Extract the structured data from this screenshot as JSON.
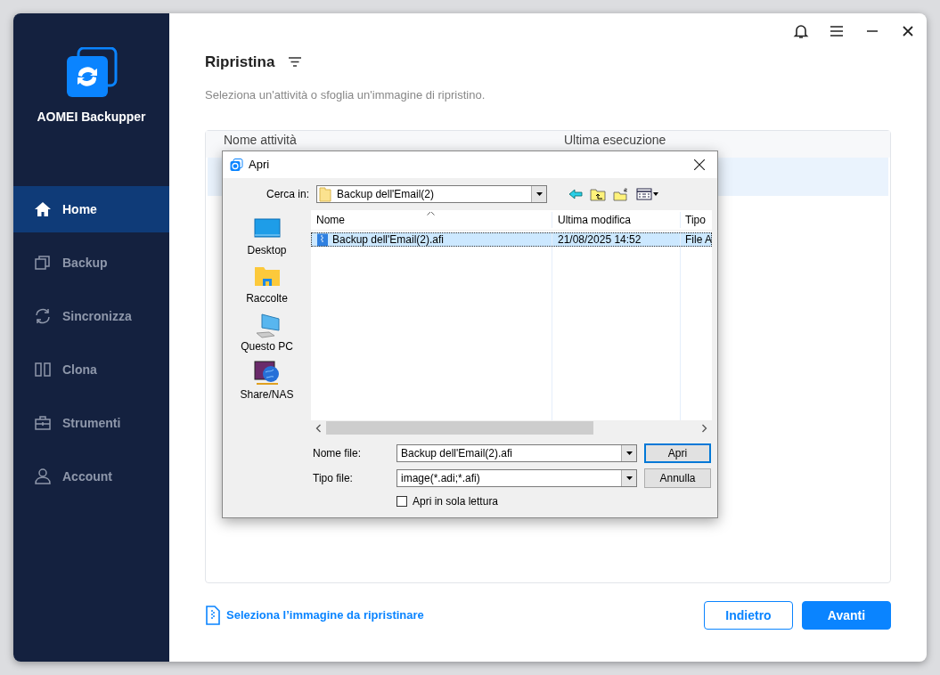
{
  "window_controls": [
    {
      "kind": "bell"
    },
    {
      "kind": "menu"
    },
    {
      "kind": "minimize"
    },
    {
      "kind": "close"
    }
  ],
  "app": {
    "name": "AOMEI Backupper"
  },
  "sidebar": {
    "items": [
      {
        "label": "Home",
        "kind": "home",
        "selected": true
      },
      {
        "label": "Backup",
        "kind": "backup",
        "selected": false
      },
      {
        "label": "Sincronizza",
        "kind": "sync",
        "selected": false
      },
      {
        "label": "Clona",
        "kind": "clone",
        "selected": false
      },
      {
        "label": "Strumenti",
        "kind": "tools",
        "selected": false
      },
      {
        "label": "Account",
        "kind": "account",
        "selected": false
      }
    ]
  },
  "page": {
    "title": "Ripristina",
    "subtitle": "Seleziona un'attività o sfoglia un'immagine di ripristino."
  },
  "table": {
    "columns": [
      "Nome attività",
      "Ultima esecuzione"
    ],
    "rows": [
      {
        "selected": true
      }
    ]
  },
  "dialog": {
    "title": "Apri",
    "look_in": {
      "label": "Cerca in:",
      "value": "Backup dell'Email(2)"
    },
    "places": [
      {
        "label": "Desktop",
        "kind": "desktop"
      },
      {
        "label": "Raccolte",
        "kind": "folder"
      },
      {
        "label": "Questo PC",
        "kind": "computer"
      },
      {
        "label": "Share/NAS",
        "kind": "network"
      }
    ],
    "files": {
      "columns": [
        "Nome",
        "Ultima modifica",
        "Tipo"
      ],
      "rows": [
        {
          "name": "Backup dell'Email(2).afi",
          "modified": "21/08/2025 14:52",
          "type": "File A",
          "selected": true
        }
      ]
    },
    "file_name": {
      "label": "Nome file:",
      "value": "Backup dell'Email(2).afi"
    },
    "file_type": {
      "label": "Tipo file:",
      "value": "image(*.adi;*.afi)"
    },
    "read_only": {
      "label": "Apri in sola lettura",
      "checked": false
    },
    "buttons": [
      {
        "label": "Apri",
        "kind": "default"
      },
      {
        "label": "Annulla",
        "kind": "normal"
      }
    ]
  },
  "footer": {
    "link": "Seleziona l’immagine da ripristinare",
    "buttons": [
      {
        "label": "Indietro",
        "kind": "outline"
      },
      {
        "label": "Avanti",
        "kind": "primary"
      }
    ]
  }
}
